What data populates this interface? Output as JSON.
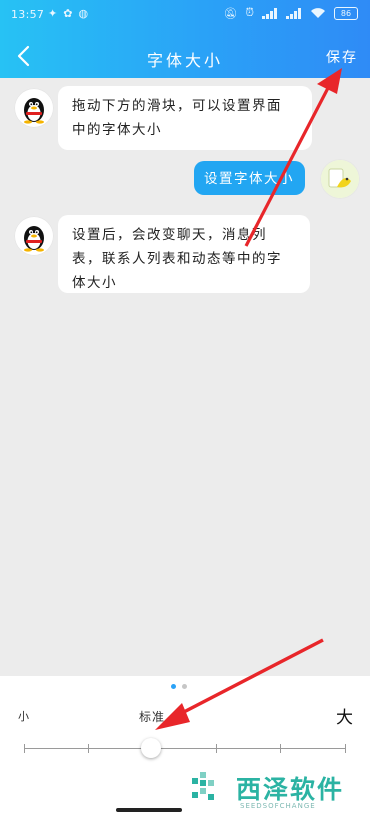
{
  "status_bar": {
    "time": "13:57",
    "notification_icons": [
      "bird-icon",
      "flower-icon",
      "app-icon"
    ],
    "battery": "86"
  },
  "nav": {
    "title": "字体大小",
    "save_label": "保存",
    "back_icon": "chevron-left-icon"
  },
  "chat": {
    "messages": [
      {
        "side": "left",
        "text1": "拖动下方的滑块，可以设置界面",
        "text2": "中的字体大小"
      },
      {
        "side": "right",
        "text1": "设置字体大小"
      },
      {
        "side": "left",
        "text1": "设置后，会改变聊天，消息列",
        "text2": "表，联系人列表和动态等中的字",
        "text3": "体大小"
      }
    ]
  },
  "font_panel": {
    "label_small": "小",
    "label_standard": "标准",
    "label_large": "大",
    "page_count": 2,
    "active_page": 1,
    "slider_steps": 6,
    "slider_value_step": 2
  },
  "colors": {
    "accent": "#2aa2f7",
    "my_bubble": "#22a6f2",
    "annotation_arrow": "#e8262a"
  },
  "watermark": {
    "brand": "西泽软件",
    "sub": "SEEDSOFCHANGE"
  }
}
